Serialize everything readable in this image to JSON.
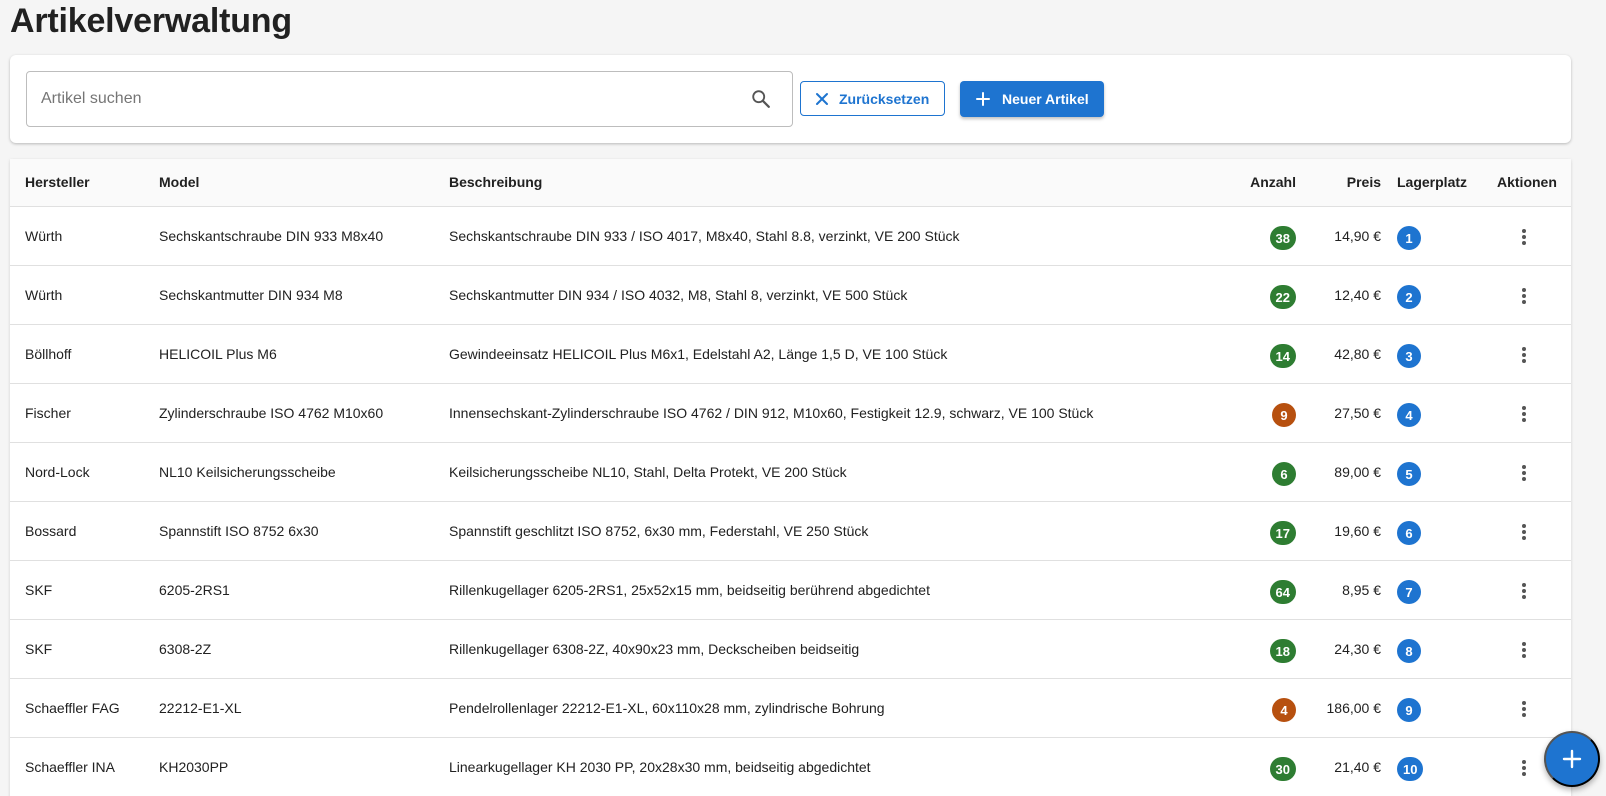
{
  "page": {
    "title": "Artikelverwaltung"
  },
  "search": {
    "placeholder": "Artikel suchen",
    "value": ""
  },
  "toolbar": {
    "reset_label": "Zurücksetzen",
    "new_label": "Neuer Artikel"
  },
  "colors": {
    "primary": "#1e74d0",
    "stock_ok": "#2e7d32",
    "stock_low": "#b7500f"
  },
  "table": {
    "headers": {
      "manufacturer": "Hersteller",
      "model": "Model",
      "description": "Beschreibung",
      "quantity": "Anzahl",
      "price": "Preis",
      "location": "Lagerplatz",
      "actions": "Aktionen"
    },
    "rows": [
      {
        "manufacturer": "Würth",
        "model": "Sechskantschraube DIN 933 M8x40",
        "description": "Sechskantschraube DIN 933 / ISO 4017, M8x40, Stahl 8.8, verzinkt, VE 200 Stück",
        "quantity": "38",
        "stock": "ok",
        "price": "14,90 €",
        "location": "1"
      },
      {
        "manufacturer": "Würth",
        "model": "Sechskantmutter DIN 934 M8",
        "description": "Sechskantmutter DIN 934 / ISO 4032, M8, Stahl 8, verzinkt, VE 500 Stück",
        "quantity": "22",
        "stock": "ok",
        "price": "12,40 €",
        "location": "2"
      },
      {
        "manufacturer": "Böllhoff",
        "model": "HELICOIL Plus M6",
        "description": "Gewindeeinsatz HELICOIL Plus M6x1, Edelstahl A2, Länge 1,5 D, VE 100 Stück",
        "quantity": "14",
        "stock": "ok",
        "price": "42,80 €",
        "location": "3"
      },
      {
        "manufacturer": "Fischer",
        "model": "Zylinderschraube ISO 4762 M10x60",
        "description": "Innensechskant-Zylinderschraube ISO 4762 / DIN 912, M10x60, Festigkeit 12.9, schwarz, VE 100 Stück",
        "quantity": "9",
        "stock": "low",
        "price": "27,50 €",
        "location": "4"
      },
      {
        "manufacturer": "Nord-Lock",
        "model": "NL10 Keilsicherungsscheibe",
        "description": "Keilsicherungsscheibe NL10, Stahl, Delta Protekt, VE 200 Stück",
        "quantity": "6",
        "stock": "ok",
        "price": "89,00 €",
        "location": "5"
      },
      {
        "manufacturer": "Bossard",
        "model": "Spannstift ISO 8752 6x30",
        "description": "Spannstift geschlitzt ISO 8752, 6x30 mm, Federstahl, VE 250 Stück",
        "quantity": "17",
        "stock": "ok",
        "price": "19,60 €",
        "location": "6"
      },
      {
        "manufacturer": "SKF",
        "model": "6205-2RS1",
        "description": "Rillenkugellager 6205-2RS1, 25x52x15 mm, beidseitig berührend abgedichtet",
        "quantity": "64",
        "stock": "ok",
        "price": "8,95 €",
        "location": "7"
      },
      {
        "manufacturer": "SKF",
        "model": "6308-2Z",
        "description": "Rillenkugellager 6308-2Z, 40x90x23 mm, Deckscheiben beidseitig",
        "quantity": "18",
        "stock": "ok",
        "price": "24,30 €",
        "location": "8"
      },
      {
        "manufacturer": "Schaeffler FAG",
        "model": "22212-E1-XL",
        "description": "Pendelrollenlager 22212-E1-XL, 60x110x28 mm, zylindrische Bohrung",
        "quantity": "4",
        "stock": "low",
        "price": "186,00 €",
        "location": "9"
      },
      {
        "manufacturer": "Schaeffler INA",
        "model": "KH2030PP",
        "description": "Linearkugellager KH 2030 PP, 20x28x30 mm, beidseitig abgedichtet",
        "quantity": "30",
        "stock": "ok",
        "price": "21,40 €",
        "location": "10"
      }
    ]
  },
  "icons": {
    "search": "search-icon",
    "reset": "close-icon",
    "add": "plus-icon",
    "row_menu": "more-vert-icon",
    "fab": "plus-icon"
  }
}
